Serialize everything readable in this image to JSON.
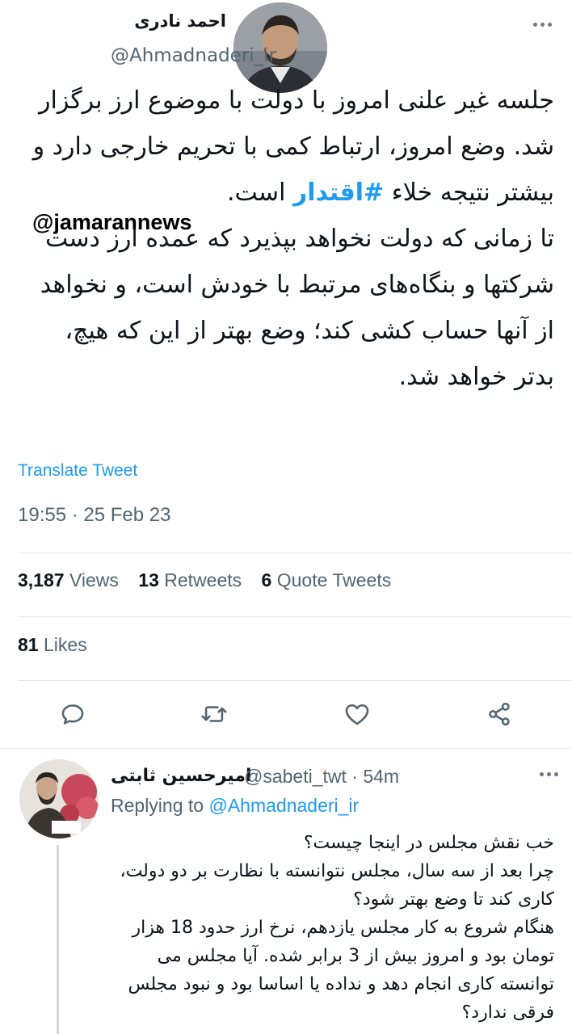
{
  "author": {
    "name": "احمد نادری",
    "handle": "@Ahmadnaderi_ir"
  },
  "tweet": {
    "paragraph1_before_hashtag": "جلسه غیر علنی امروز با دولت با موضوع ارز برگزار شد. وضع امروز، ارتباط کمی با تحریم خارجی دارد و بیشتر نتیجه خلاء ",
    "hashtag": "#اقتدار",
    "paragraph1_after_hashtag": " است.",
    "paragraph2": "تا زمانی که دولت نخواهد بپذیرد که عمده ارز دست شرکتها و بنگاه‌های مرتبط با خودش است، و نخواهد از آنها حساب کشی کند؛ وضع بهتر از این که هیچ، بدتر خواهد شد.",
    "watermark": "@jamarannews",
    "translate_label": "Translate Tweet",
    "timestamp": "19:55 · 25 Feb 23"
  },
  "stats": {
    "views_count": "3,187",
    "views_label": "Views",
    "retweets_count": "13",
    "retweets_label": "Retweets",
    "quotes_count": "6",
    "quotes_label": "Quote Tweets",
    "likes_count": "81",
    "likes_label": "Likes"
  },
  "actions": {
    "icons": [
      "reply-icon",
      "retweet-icon",
      "like-icon",
      "share-icon"
    ],
    "color": "#536471"
  },
  "reply": {
    "name": "امیرحسین ثابتی",
    "handle_time": "@sabeti_twt · 54m",
    "replying_prefix": "Replying to",
    "replying_to": "@Ahmadnaderi_ir",
    "body": "خب نقش مجلس در اینجا چیست؟\nچرا بعد از سه سال، مجلس نتوانسته با نظارت بر دو دولت، کاری کند تا وضع بهتر شود؟\nهنگام شروع به کار مجلس یازدهم، نرخ ارز حدود 18 هزار تومان بود و امروز بیش از 3 برابر شده. آیا مجلس می توانسته کاری انجام دهد و نداده یا اساسا بود و نبود مجلس فرقی ندارد؟"
  },
  "colors": {
    "accent": "#1d9bf0",
    "secondary_text": "#536471",
    "primary_text": "#0f1419",
    "divider": "#e3e8ec"
  }
}
